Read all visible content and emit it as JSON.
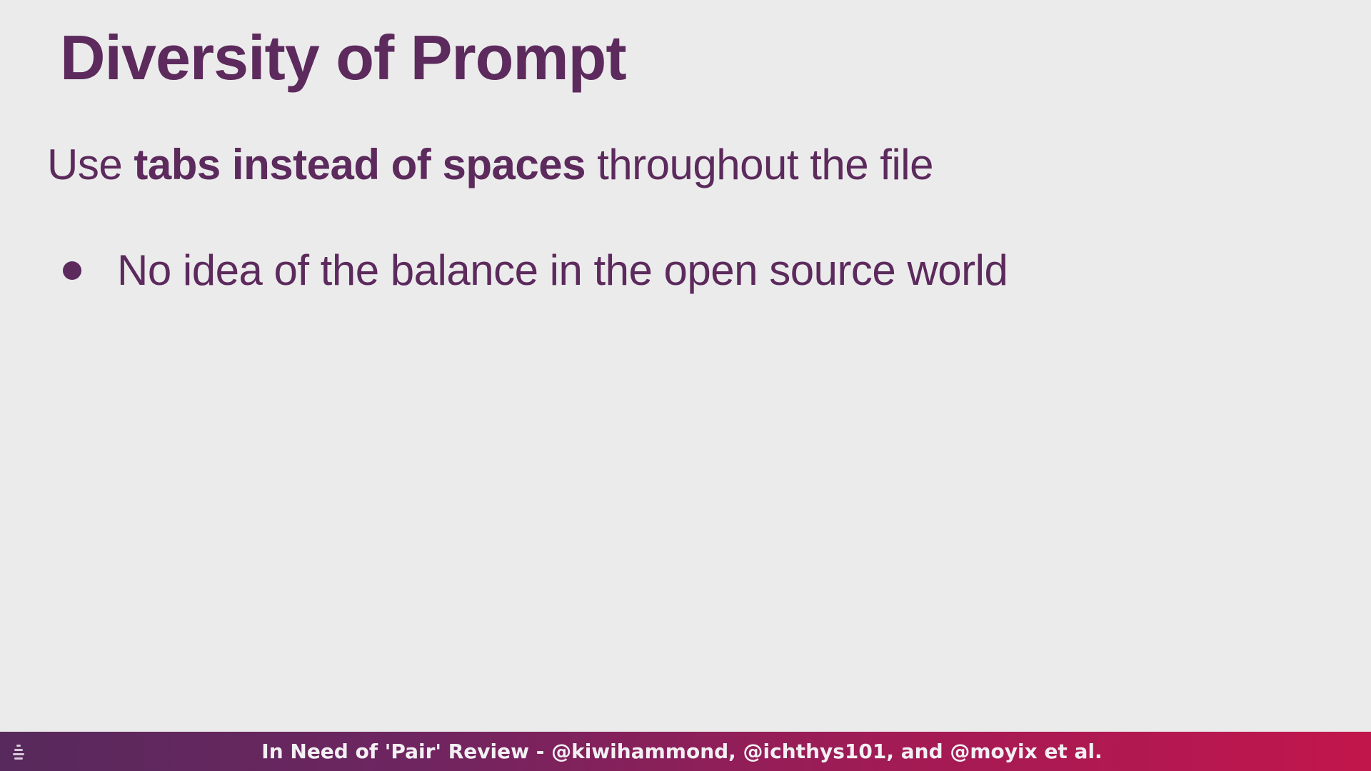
{
  "slide": {
    "title": "Diversity of Prompt",
    "subtitle": {
      "prefix": "Use ",
      "bold": "tabs instead of spaces",
      "suffix": " throughout the file"
    },
    "bullets": [
      "No idea of the balance in the open source world"
    ]
  },
  "footer": {
    "text": "In Need of 'Pair' Review - @kiwihammond, @ichthys101, and @moyix et al.",
    "logo_icon": "stacked-arcs-logo-icon"
  },
  "colors": {
    "text": "#5c2a5c",
    "background": "#ebebeb",
    "footer_start": "#57295c",
    "footer_end": "#c1164c"
  }
}
